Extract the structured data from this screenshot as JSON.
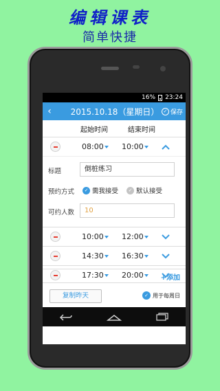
{
  "promo": {
    "title": "编辑课表",
    "subtitle": "简单快捷"
  },
  "statusbar": {
    "battery": "16%",
    "time": "23:24"
  },
  "appbar": {
    "back_icon": "chevron-left",
    "title": "2015.10.18（星期日）",
    "save_label": "保存"
  },
  "columns": {
    "start": "起始时间",
    "end": "结束时间"
  },
  "slots": [
    {
      "start": "08:00",
      "end": "10:00",
      "expanded": true
    },
    {
      "start": "10:00",
      "end": "12:00",
      "expanded": false
    },
    {
      "start": "14:30",
      "end": "16:30",
      "expanded": false
    },
    {
      "start": "17:30",
      "end": "20:00",
      "expanded": false
    }
  ],
  "detail": {
    "title_label": "标题",
    "title_value": "倒桩练习",
    "booking_label": "预约方式",
    "option_accept": "需我接受",
    "option_default": "默认接受",
    "capacity_label": "可约人数",
    "capacity_placeholder": "10"
  },
  "actions": {
    "add_label": "添加",
    "copy_label": "复制昨天",
    "weekly_label": "用于每周日"
  },
  "colors": {
    "accent": "#3a9be0",
    "background": "#90f3a0",
    "minus": "#e63c30"
  }
}
